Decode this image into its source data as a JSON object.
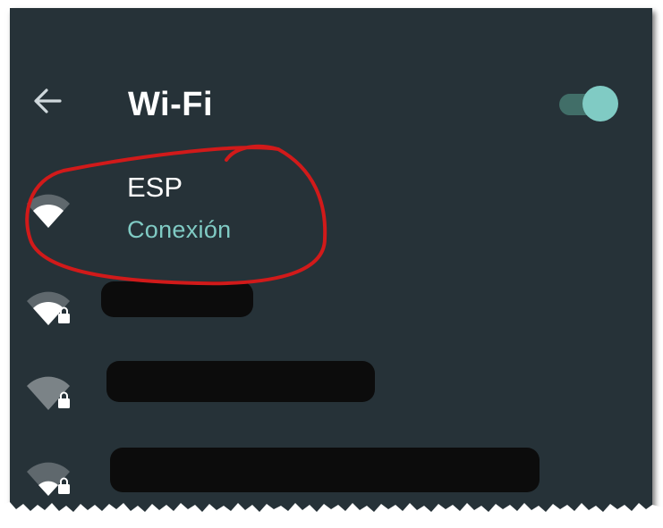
{
  "header": {
    "title": "Wi-Fi",
    "back_icon": "arrow-back-icon",
    "toggle_state": "on"
  },
  "colors": {
    "background": "#263238",
    "accent": "#80cbc4",
    "toggle_track": "#416e68",
    "annotation": "#d11a1a"
  },
  "networks": [
    {
      "name": "ESP",
      "status": "Conexión",
      "icon": "wifi-signal-icon",
      "locked": false,
      "connected": true
    },
    {
      "name": "",
      "status": "",
      "icon": "wifi-signal-lock-icon",
      "locked": true,
      "redacted": true
    },
    {
      "name": "",
      "status": "",
      "icon": "wifi-signal-lock-icon",
      "locked": true,
      "redacted": true
    },
    {
      "name": "",
      "status": "",
      "icon": "wifi-signal-lock-icon",
      "locked": true,
      "redacted": true
    }
  ]
}
